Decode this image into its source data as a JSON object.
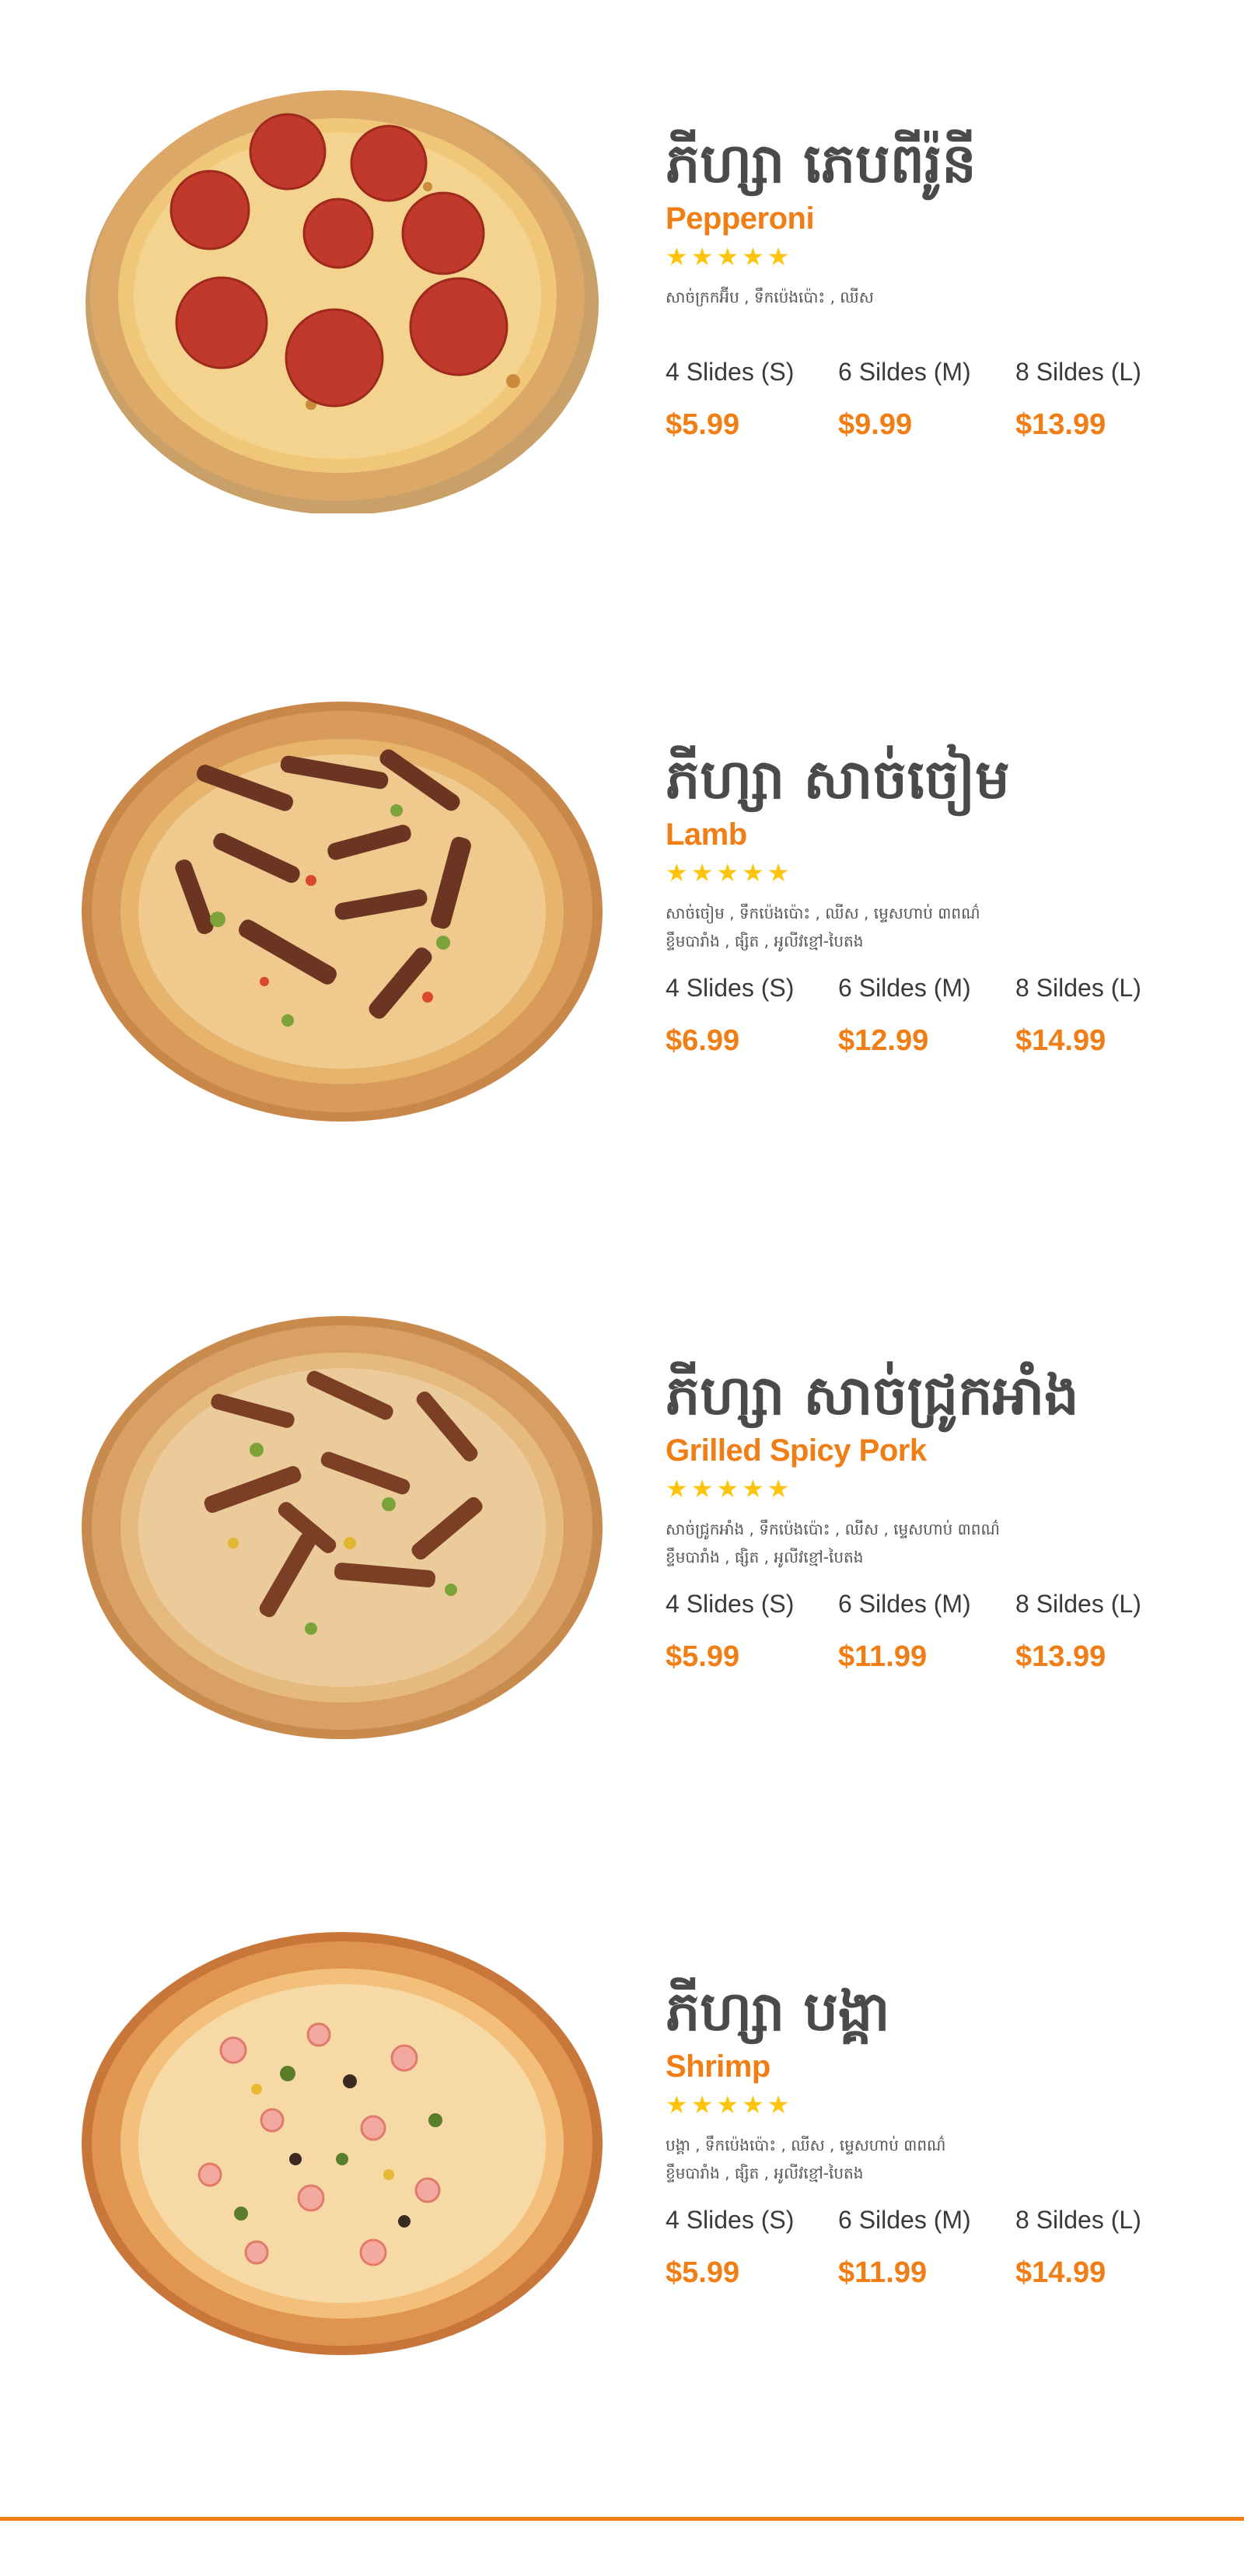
{
  "colors": {
    "accent": "#f07e15",
    "star": "#ffc40c",
    "title": "#4a4a4a",
    "text": "#3a3a3a"
  },
  "menu": [
    {
      "title_km": "ភីហ្សា ភេបពីរ៉ូនី",
      "title_en": "Pepperoni",
      "rating": 5,
      "stars": "★★★★★",
      "desc_lines": [
        "សាច់ក្រកអ៊ីប , ទឹកប៉េងប៉ោះ , ឈីស",
        ""
      ],
      "topping": "pepperoni",
      "sizes": [
        {
          "label": "4 Slides (S)",
          "price": "$5.99"
        },
        {
          "label": "6 Sildes (M)",
          "price": "$9.99"
        },
        {
          "label": "8 Sildes (L)",
          "price": "$13.99"
        }
      ]
    },
    {
      "title_km": "ភីហ្សា សាច់ចៀម",
      "title_en": "Lamb",
      "rating": 5,
      "stars": "★★★★★",
      "desc_lines": [
        "សាច់ចៀម , ទឹកប៉េងប៉ោះ , ឈីស , ម្ទេសហាប់ ៣ពណ៌",
        "ខ្ទឹមបារាំង , ផ្សិត , អូលីវខ្មៅ-បៃតង"
      ],
      "topping": "lamb",
      "sizes": [
        {
          "label": "4 Slides (S)",
          "price": "$6.99"
        },
        {
          "label": "6 Sildes (M)",
          "price": "$12.99"
        },
        {
          "label": "8 Sildes (L)",
          "price": "$14.99"
        }
      ]
    },
    {
      "title_km": "ភីហ្សា សាច់ជ្រូកអាំង",
      "title_en": "Grilled Spicy Pork",
      "rating": 5,
      "stars": "★★★★★",
      "desc_lines": [
        "សាច់ជ្រូកអាំង , ទឹកប៉េងប៉ោះ , ឈីស , ម្ទេសហាប់ ៣ពណ៌",
        "ខ្ទឹមបារាំង , ផ្សិត , អូលីវខ្មៅ-បៃតង"
      ],
      "topping": "pork",
      "sizes": [
        {
          "label": "4 Slides (S)",
          "price": "$5.99"
        },
        {
          "label": "6 Sildes (M)",
          "price": "$11.99"
        },
        {
          "label": "8 Sildes (L)",
          "price": "$13.99"
        }
      ]
    },
    {
      "title_km": "ភីហ្សា បង្គា",
      "title_en": "Shrimp",
      "rating": 5,
      "stars": "★★★★★",
      "desc_lines": [
        "បង្គា , ទឹកប៉េងប៉ោះ , ឈីស , ម្ទេសហាប់ ៣ពណ៌",
        "ខ្ទឹមបារាំង , ផ្សិត , អូលីវខ្មៅ-បៃតង"
      ],
      "topping": "shrimp",
      "sizes": [
        {
          "label": "4 Slides (S)",
          "price": "$5.99"
        },
        {
          "label": "6 Sildes (M)",
          "price": "$11.99"
        },
        {
          "label": "8 Sildes (L)",
          "price": "$14.99"
        }
      ]
    }
  ]
}
